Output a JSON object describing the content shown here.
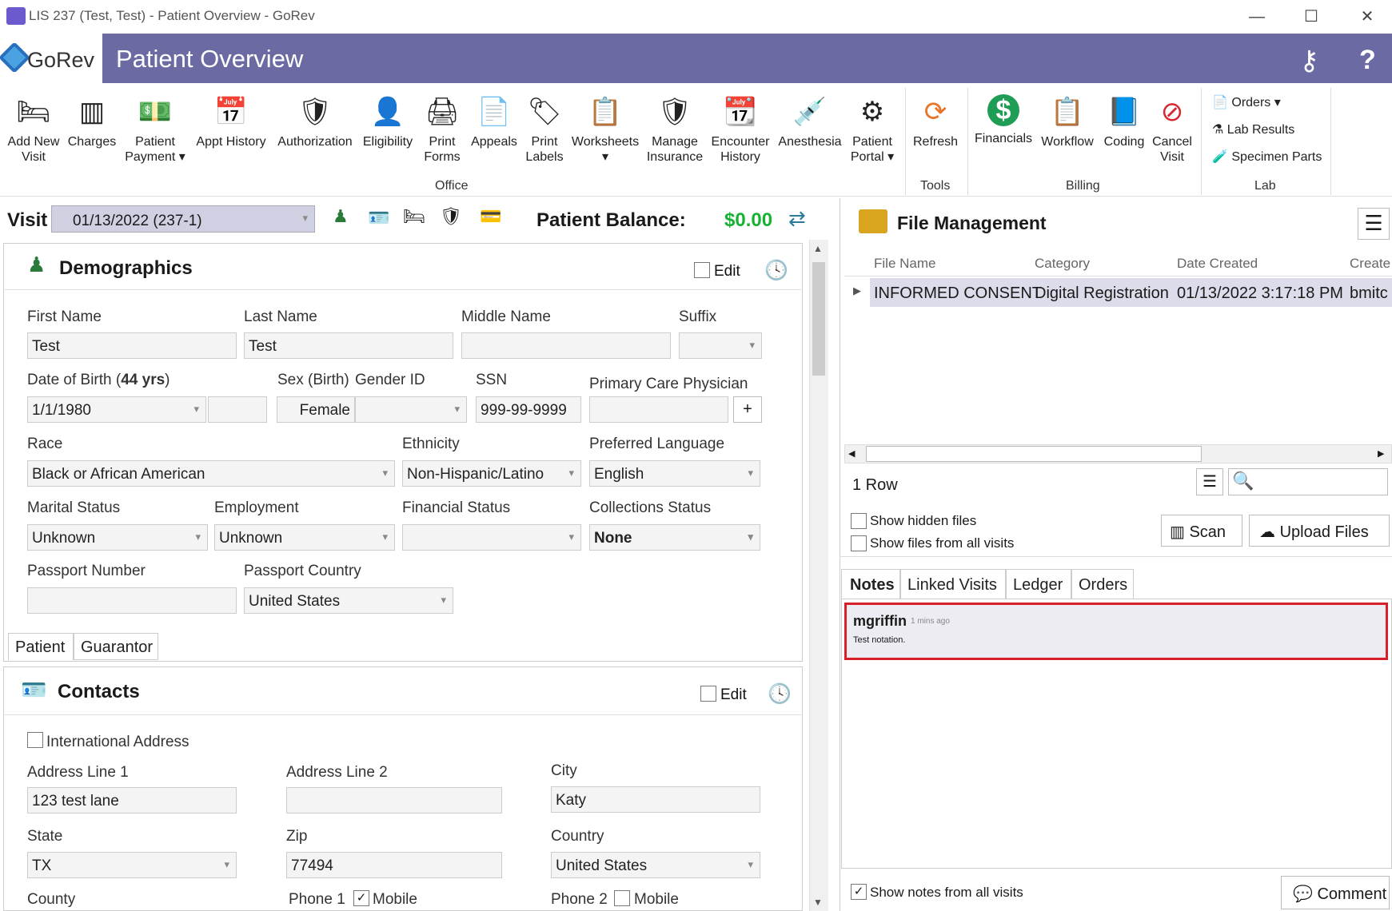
{
  "window": {
    "title": "LIS 237 (Test, Test) - Patient Overview - GoRev",
    "min": "—",
    "max": "☐",
    "close": "✕"
  },
  "header": {
    "logo": "GoRev",
    "title": "Patient Overview",
    "keys_icon": "⚷",
    "help": "?"
  },
  "ribbon": {
    "items": [
      {
        "label1": "Add New",
        "label2": "Visit",
        "icon": "🛏"
      },
      {
        "label1": "Charges",
        "label2": "",
        "icon": "▥"
      },
      {
        "label1": "Patient",
        "label2": "Payment ▾",
        "icon": "💵"
      },
      {
        "label1": "Appt History",
        "label2": "",
        "icon": "📅"
      },
      {
        "label1": "Authorization",
        "label2": "",
        "icon": "🛡"
      },
      {
        "label1": "Eligibility",
        "label2": "",
        "icon": "👤"
      },
      {
        "label1": "Print",
        "label2": "Forms",
        "icon": "🖨"
      },
      {
        "label1": "Appeals",
        "label2": "",
        "icon": "📄"
      },
      {
        "label1": "Print",
        "label2": "Labels",
        "icon": "🏷"
      },
      {
        "label1": "Worksheets",
        "label2": "▾",
        "icon": "📋"
      },
      {
        "label1": "Manage",
        "label2": "Insurance",
        "icon": "🛡"
      },
      {
        "label1": "Encounter",
        "label2": "History",
        "icon": "📆"
      },
      {
        "label1": "Anesthesia",
        "label2": "",
        "icon": "💉"
      },
      {
        "label1": "Patient",
        "label2": "Portal ▾",
        "icon": "⚙"
      },
      {
        "label1": "Refresh",
        "label2": "",
        "icon": "⟳"
      },
      {
        "label1": "Financials",
        "label2": "",
        "icon": "$"
      },
      {
        "label1": "Workflow",
        "label2": "",
        "icon": "📋"
      },
      {
        "label1": "Coding",
        "label2": "",
        "icon": "📘"
      },
      {
        "label1": "Cancel",
        "label2": "Visit",
        "icon": "⊘"
      }
    ],
    "groups": {
      "office": "Office",
      "tools": "Tools",
      "billing": "Billing",
      "lab": "Lab"
    },
    "lab": {
      "orders": "Orders ▾",
      "results": "Lab Results",
      "specimen": "Specimen Parts"
    }
  },
  "visit": {
    "label": "Visit",
    "value": "01/13/2022 (237-1)",
    "balance_label": "Patient Balance:",
    "balance": "$0.00",
    "color_balance": "#17b232"
  },
  "demographics": {
    "title": "Demographics",
    "edit": "Edit",
    "first_name_l": "First Name",
    "first_name": "Test",
    "last_name_l": "Last Name",
    "last_name": "Test",
    "middle_name_l": "Middle Name",
    "middle_name": "",
    "suffix_l": "Suffix",
    "suffix": "",
    "dob_l": "Date of Birth (",
    "dob_age": "44 yrs",
    "dob_close": ")",
    "dob": "1/1/1980",
    "sex_l": "Sex (Birth)",
    "gender_l": "Gender ID",
    "sex": "Female",
    "ssn_l": "SSN",
    "ssn": "999-99-9999",
    "pcp_l": "Primary Care Physician",
    "pcp_add": "+",
    "race_l": "Race",
    "race": "Black or African American",
    "eth_l": "Ethnicity",
    "eth": "Non-Hispanic/Latino",
    "lang_l": "Preferred Language",
    "lang": "English",
    "marital_l": "Marital Status",
    "marital": "Unknown",
    "emp_l": "Employment",
    "emp": "Unknown",
    "fin_l": "Financial Status",
    "fin": "",
    "coll_l": "Collections Status",
    "coll": "None",
    "pass_l": "Passport Number",
    "pass": "",
    "pcountry_l": "Passport Country",
    "pcountry": "United States",
    "tab_patient": "Patient",
    "tab_guarantor": "Guarantor"
  },
  "contacts": {
    "title": "Contacts",
    "edit": "Edit",
    "intl": "International Address",
    "addr1_l": "Address Line 1",
    "addr1": "123 test lane",
    "addr2_l": "Address Line 2",
    "addr2": "",
    "city_l": "City",
    "city": "Katy",
    "state_l": "State",
    "state": "TX",
    "zip_l": "Zip",
    "zip": "77494",
    "country_l": "Country",
    "country": "United States",
    "county_l": "County",
    "phone1_l": "Phone 1",
    "mobile1": "Mobile",
    "phone2_l": "Phone 2",
    "mobile2": "Mobile"
  },
  "files": {
    "title": "File Management",
    "cols": [
      "File Name",
      "Category",
      "Date Created",
      "Create"
    ],
    "row": [
      "INFORMED CONSENT",
      "Digital Registration",
      "01/13/2022 3:17:18 PM",
      "bmitc"
    ],
    "rows_count": "1 Row",
    "show_hidden": "Show hidden files",
    "show_all": "Show files from all visits",
    "scan": "Scan",
    "upload": "Upload Files"
  },
  "notes": {
    "tabs": [
      "Notes",
      "Linked Visits",
      "Ledger",
      "Orders"
    ],
    "author": "mgriffin",
    "time": "1 mins ago",
    "text": "Test notation.",
    "show_all": "Show notes from all visits",
    "comment": "Comment"
  }
}
